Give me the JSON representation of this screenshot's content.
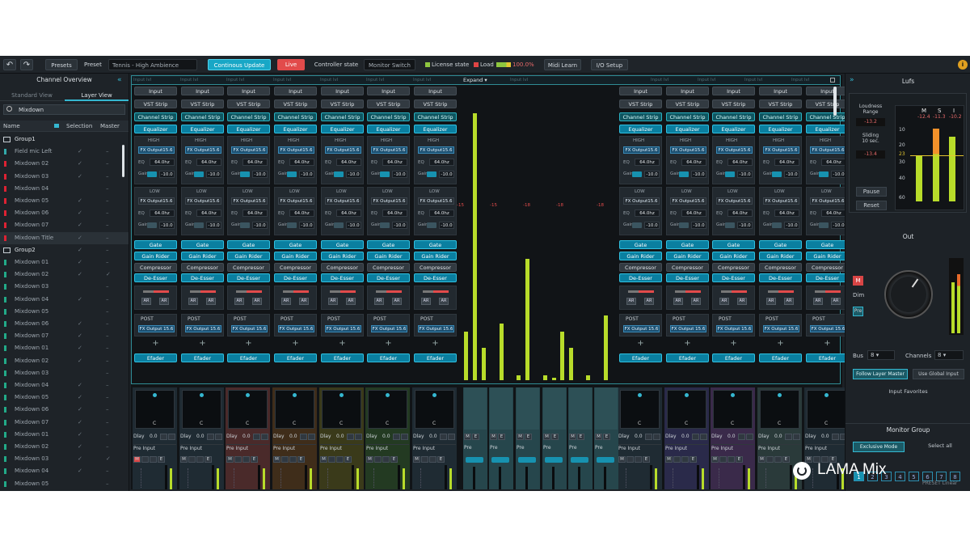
{
  "toolbar": {
    "undo": "↶",
    "redo": "↷",
    "presets": "Presets",
    "preset_label": "Preset",
    "preset_value": "Tennis - High Ambience",
    "continuous": "Continous Update",
    "live": "Live",
    "controller_state": "Controller state",
    "monitor_switch": "Monitor Switch",
    "license": "License state",
    "load": "Load",
    "load_pct": "100.0%",
    "midi_learn": "Midi Learn",
    "io_setup": "I/O Setup",
    "info": "i"
  },
  "left": {
    "title": "Channel Overview",
    "collapse": "«",
    "tabs": [
      "Standard View",
      "Layer View"
    ],
    "search": "Mixdown",
    "cols": [
      "Name",
      "Selection",
      "Master"
    ],
    "rows": [
      {
        "n": "Group1",
        "c": "",
        "m": "",
        "g": true
      },
      {
        "n": "Field mic Left",
        "c": "✓",
        "m": "–",
        "col": "#3aa"
      },
      {
        "n": "Mixdown 02",
        "c": "✓",
        "m": "–",
        "col": "#d23"
      },
      {
        "n": "Mixdown 03",
        "c": "✓",
        "m": "–",
        "col": "#d23"
      },
      {
        "n": "Mixdown 04",
        "c": "",
        "m": "–",
        "col": "#d23"
      },
      {
        "n": "Mixdown 05",
        "c": "✓",
        "m": "–",
        "col": "#d23"
      },
      {
        "n": "Mixdown 06",
        "c": "✓",
        "m": "–",
        "col": "#d23"
      },
      {
        "n": "Mixdown 07",
        "c": "✓",
        "m": "–",
        "col": "#d23"
      },
      {
        "n": "Mixdown Title",
        "c": "✓",
        "m": "–",
        "col": "#d23"
      },
      {
        "n": "Group2",
        "c": "✓",
        "m": "–",
        "g": true
      },
      {
        "n": "Mixdown 01",
        "c": "✓",
        "m": "–",
        "col": "#2a8"
      },
      {
        "n": "Mixdown 02",
        "c": "✓",
        "m": "✓",
        "col": "#2a8"
      },
      {
        "n": "Mixdown 03",
        "c": "",
        "m": "–",
        "col": "#2a8"
      },
      {
        "n": "Mixdown 04",
        "c": "✓",
        "m": "–",
        "col": "#2a8"
      },
      {
        "n": "Mixdown 05",
        "c": "",
        "m": "–",
        "col": "#2a8"
      },
      {
        "n": "Mixdown 06",
        "c": "✓",
        "m": "–",
        "col": "#2a8"
      },
      {
        "n": "Mixdown 07",
        "c": "✓",
        "m": "–",
        "col": "#2a8"
      },
      {
        "n": "Mixdown 01",
        "c": "✓",
        "m": "–",
        "col": "#2a8"
      },
      {
        "n": "Mixdown 02",
        "c": "✓",
        "m": "–",
        "col": "#2a8"
      },
      {
        "n": "Mixdown 03",
        "c": "",
        "m": "–",
        "col": "#2a8"
      },
      {
        "n": "Mixdown 04",
        "c": "✓",
        "m": "–",
        "col": "#2a8"
      },
      {
        "n": "Mixdown 05",
        "c": "✓",
        "m": "–",
        "col": "#2a8"
      },
      {
        "n": "Mixdown 06",
        "c": "✓",
        "m": "–",
        "col": "#2a8"
      },
      {
        "n": "Mixdown 07",
        "c": "✓",
        "m": "–",
        "col": "#2a8"
      },
      {
        "n": "Mixdown 01",
        "c": "✓",
        "m": "–",
        "col": "#2a8"
      },
      {
        "n": "Mixdown 02",
        "c": "✓",
        "m": "–",
        "col": "#2a8"
      },
      {
        "n": "Mixdown 03",
        "c": "✓",
        "m": "✓",
        "col": "#2a8"
      },
      {
        "n": "Mixdown 04",
        "c": "✓",
        "m": "–",
        "col": "#2a8"
      },
      {
        "n": "Mixdown 05",
        "c": "",
        "m": "–",
        "col": "#2a8"
      }
    ]
  },
  "expand": {
    "label": "Expand",
    "slot": "Input lvl"
  },
  "strip": {
    "input": "Input",
    "vst": "VST Strip",
    "cstrip": "Channel Strip",
    "eq": "Equalizer",
    "high": "HIGH",
    "low": "LOW",
    "fx": "FX Output15.6",
    "eq_l": "EQ",
    "eq_v": "64.0hz",
    "gain_l": "Gain",
    "gain_v": "-10.0",
    "gate": "Gate",
    "rider": "Gain Rider",
    "comp": "Compressor",
    "deesser": "De-Esser",
    "ar": "AR",
    "post": "POST",
    "fx2": "FX Output 15.6",
    "efader": "Efader",
    "plus": "+",
    "dlay": "Dlay",
    "dval": "0.0",
    "pre": "Pre Input",
    "pre_short": "Pre",
    "c": "C",
    "m": "M",
    "e": "E"
  },
  "center": {
    "minus15": "-15",
    "minus18": "-18"
  },
  "right": {
    "collapse": "»",
    "title": "Lufs",
    "range_label": "Loudness Range",
    "range_val": "-13.2",
    "sliding_label": "Sliding 10 sec.",
    "sliding_val": "-13.4",
    "m": "M",
    "s": "S",
    "i": "I",
    "mv": "-12.4",
    "sv": "-11.3",
    "iv": "-10.2",
    "scale": [
      "10",
      "20",
      "23",
      "30",
      "40",
      "60"
    ],
    "pause": "Pause",
    "reset": "Reset",
    "out": "Out",
    "mute": "M",
    "dim": "Dim",
    "pre": "Pre",
    "bus_l": "Bus",
    "bus_v": "8",
    "ch_l": "Channels",
    "ch_v": "8",
    "follow": "Follow Layer Master",
    "global": "Use Global Input",
    "fav_title": "Input Favorites",
    "favs": [
      "1",
      "2",
      "3",
      "4",
      "5",
      "6",
      "7",
      "8"
    ],
    "monitor": "Monitor Group",
    "exclusive": "Exclusive Mode",
    "select_all": "Select all",
    "preset_label": "PRESET Linear"
  },
  "logo": "LAMA Mix"
}
